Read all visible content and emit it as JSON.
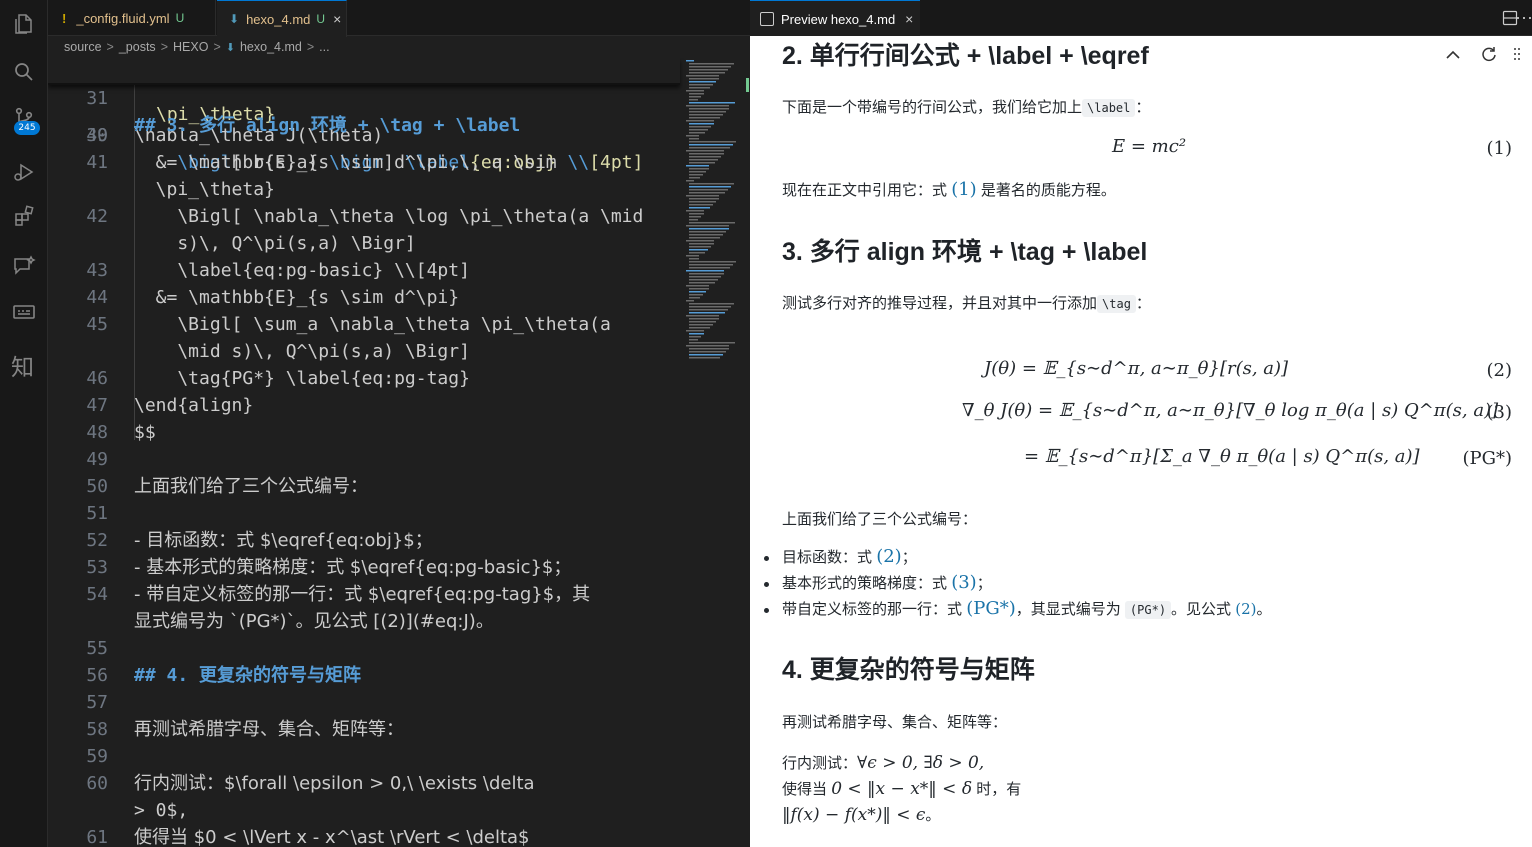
{
  "colors": {
    "accent": "#0078d4",
    "editor_bg": "#1f1f1f",
    "heading": "#569cd6",
    "string": "#ce9178",
    "fn": "#dcdcaa",
    "untracked": "#73c991"
  },
  "activity": {
    "scm_badge": "245",
    "zhi": "知"
  },
  "tabs": [
    {
      "icon": "warning-exclaim-icon",
      "mark": "!",
      "name": "_config.fluid.yml",
      "flag": "U"
    },
    {
      "icon": "markdown-file-icon",
      "name": "hexo_4.md",
      "flag": "U",
      "close": "×"
    }
  ],
  "breadcrumb": {
    "parts": [
      "source",
      "_posts",
      "HEXO"
    ],
    "file": "hexo_4.md",
    "more": "...",
    "sep": ">"
  },
  "code": {
    "sticky": {
      "ln": "31",
      "text": "## 3. 多行 align 环境 + \\tag + \\label"
    },
    "partial_text": "\\pi_\\theta}",
    "lines": [
      {
        "ln": "39",
        "t1": "    \\bigl",
        "t2": "[ r(s,a) ",
        "t3": "\\bigr",
        "t4": "] ",
        "t5": "\\label",
        "t6": "{eq:obj}",
        "t7": " \\\\",
        "t8": "[4pt]"
      },
      {
        "ln": "40",
        "text": "\\nabla_\\theta J(\\theta)"
      },
      {
        "ln": "41",
        "text": "  &= \\mathbb{E}_{s \\sim d^\\pi,\\, a \\sim"
      },
      {
        "ln": "",
        "text": "  \\pi_\\theta}"
      },
      {
        "ln": "42",
        "text": "    \\Bigl[ \\nabla_\\theta \\log \\pi_\\theta(a \\mid"
      },
      {
        "ln": "",
        "text": "    s)\\, Q^\\pi(s,a) \\Bigr]"
      },
      {
        "ln": "43",
        "text": "    \\label{eq:pg-basic} \\\\[4pt]"
      },
      {
        "ln": "44",
        "text": "  &= \\mathbb{E}_{s \\sim d^\\pi}"
      },
      {
        "ln": "45",
        "text": "    \\Bigl[ \\sum_a \\nabla_\\theta \\pi_\\theta(a"
      },
      {
        "ln": "",
        "text": "    \\mid s)\\, Q^\\pi(s,a) \\Bigr]"
      },
      {
        "ln": "46",
        "text": "    \\tag{PG*} \\label{eq:pg-tag}"
      },
      {
        "ln": "47",
        "text": "\\end{align}"
      },
      {
        "ln": "48",
        "text": "$$"
      },
      {
        "ln": "49",
        "text": ""
      },
      {
        "ln": "50",
        "text": "上面我们给了三个公式编号："
      },
      {
        "ln": "51",
        "text": ""
      },
      {
        "ln": "52",
        "text": "- 目标函数：式 $\\eqref{eq:obj}$；"
      },
      {
        "ln": "53",
        "text": "- 基本形式的策略梯度：式 $\\eqref{eq:pg-basic}$；"
      },
      {
        "ln": "54",
        "text": "- 带自定义标签的那一行：式 $\\eqref{eq:pg-tag}$，其"
      },
      {
        "ln": "",
        "text": "显式编号为 `(PG*)`。见公式 [(2)](#eq:J)。"
      },
      {
        "ln": "55",
        "text": ""
      },
      {
        "ln": "56",
        "text": "## 4. 更复杂的符号与矩阵"
      },
      {
        "ln": "57",
        "text": ""
      },
      {
        "ln": "58",
        "text": "再测试希腊字母、集合、矩阵等："
      },
      {
        "ln": "59",
        "text": ""
      },
      {
        "ln": "60",
        "text": "行内测试：$\\forall \\epsilon > 0,\\ \\exists \\delta"
      },
      {
        "ln": "",
        "text": "> 0$,"
      },
      {
        "ln": "61",
        "text": "使得当 $0 < \\lVert x - x^\\ast \\rVert < \\delta$"
      }
    ]
  },
  "preview_tab": {
    "title": "Preview hexo_4.md",
    "close": "×",
    "more": "···"
  },
  "preview": {
    "h2_a": "2. 单行行间公式 + \\label + \\eqref",
    "p1_pre": "下面是一个带编号的行间公式，我们给它加上",
    "p1_code": "\\label",
    "p1_post": "：",
    "eq1": "E = mc²",
    "eq1_num": "(1)",
    "p2_pre": "现在在正文中引用它：式",
    "p2_ref": "(1)",
    "p2_post": "是著名的质能方程。",
    "h2_b": "3. 多行 align 环境 + \\tag + \\label",
    "p3_pre": "测试多行对齐的推导过程，并且对其中一行添加",
    "p3_code": "\\tag",
    "p3_post": "：",
    "eq2_lhs": "J(θ)",
    "eq2_rhs": "= 𝔼_{s∼d^π, a∼π_θ}[r(s, a)]",
    "eq2_num": "(2)",
    "eq3_lhs": "∇_θ J(θ)",
    "eq3_rhs": "= 𝔼_{s∼d^π, a∼π_θ}[∇_θ log π_θ(a | s) Q^π(s, a)]",
    "eq3_num": "(3)",
    "eq4_rhs": "= 𝔼_{s∼d^π}[Σ_a ∇_θ π_θ(a | s) Q^π(s, a)]",
    "eq4_num": "(PG*)",
    "p4": "上面我们给了三个公式编号：",
    "li1_pre": "目标函数：式",
    "li1_ref": "(2)",
    "li1_post": "；",
    "li2_pre": "基本形式的策略梯度：式",
    "li2_ref": "(3)",
    "li2_post": "；",
    "li3_pre": "带自定义标签的那一行：式",
    "li3_ref": "(PG*)",
    "li3_mid": "，其显式编号为",
    "li3_code": "(PG*)",
    "li3_mid2": "。见公式",
    "li3_link": "(2)",
    "li3_post": "。",
    "h2_c": "4. 更复杂的符号与矩阵",
    "p5": "再测试希腊字母、集合、矩阵等：",
    "p6_pre": "行内测试：",
    "p6_math": "∀ϵ > 0, ∃δ > 0,",
    "p7_pre": "使得当",
    "p7_math": "0 < ‖x − x*‖ < δ",
    "p7_post": "时，有",
    "p8_math": "‖f(x) − f(x*)‖ < ϵ",
    "p8_post": "。"
  }
}
